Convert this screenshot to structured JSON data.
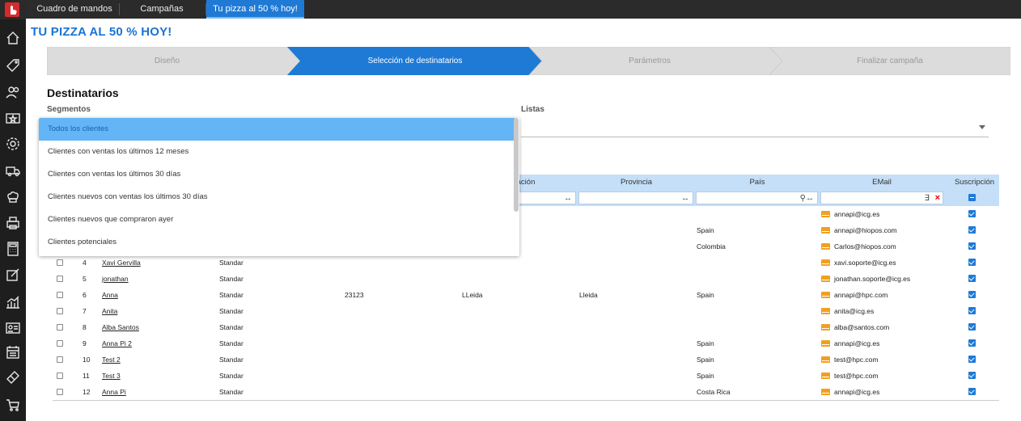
{
  "topbar": {
    "tabs": [
      {
        "label": "Cuadro de mandos"
      },
      {
        "label": "Campañas"
      },
      {
        "label": "Tu pizza al 50 % hoy!"
      }
    ]
  },
  "sidebar": {
    "icons": [
      "home-icon",
      "tag-icon",
      "users-icon",
      "star-ticket-icon",
      "gear-icon",
      "truck-icon",
      "chef-hat-icon",
      "printer-icon",
      "calculator-icon",
      "edit-icon",
      "chart-icon",
      "id-card-icon",
      "calendar-icon",
      "ticket-icon",
      "cart-icon"
    ]
  },
  "page": {
    "title": "TU PIZZA AL 50 % HOY!"
  },
  "wizard": {
    "steps": [
      {
        "label": "Diseño"
      },
      {
        "label": "Selección de destinatarios"
      },
      {
        "label": "Parámetros"
      },
      {
        "label": "Finalizar campaña"
      }
    ],
    "active_color": "#1f7ad6"
  },
  "recipients": {
    "title": "Destinatarios",
    "segments_label": "Segmentos",
    "lists_label": "Listas"
  },
  "grid": {
    "headers": {
      "poblacion": "ación",
      "provincia": "Provincia",
      "pais": "País",
      "email": "EMail",
      "suscripcion": "Suscripción"
    },
    "rows": [
      {
        "num": "",
        "name": "",
        "type": "",
        "cp": "",
        "pob": "",
        "prov": "",
        "pais": "",
        "email": "annapi@icg.es"
      },
      {
        "num": "",
        "name": "",
        "type": "",
        "cp": "",
        "pob": "",
        "prov": "",
        "pais": "Spain",
        "email": "annapi@hiopos.com"
      },
      {
        "num": "",
        "name": "",
        "type": "",
        "cp": "",
        "pob": "",
        "prov": "",
        "pais": "Colombia",
        "email": "Carlos@hiopos.com"
      },
      {
        "num": "4",
        "name": "Xavi Gervilla",
        "type": "Standar",
        "cp": "",
        "pob": "",
        "prov": "",
        "pais": "",
        "email": "xavi.soporte@icg.es"
      },
      {
        "num": "5",
        "name": "jonathan",
        "type": "Standar",
        "cp": "",
        "pob": "",
        "prov": "",
        "pais": "",
        "email": "jonathan.soporte@icg.es"
      },
      {
        "num": "6",
        "name": "Anna",
        "type": "Standar",
        "cp": "23123",
        "pob": "LLeida",
        "prov": "Lleida",
        "pais": "Spain",
        "email": "annapi@hpc.com"
      },
      {
        "num": "7",
        "name": "Anita",
        "type": "Standar",
        "cp": "",
        "pob": "",
        "prov": "",
        "pais": "",
        "email": "anita@icg.es"
      },
      {
        "num": "8",
        "name": "Alba Santos",
        "type": "Standar",
        "cp": "",
        "pob": "",
        "prov": "",
        "pais": "",
        "email": "alba@santos.com"
      },
      {
        "num": "9",
        "name": "Anna Pi 2",
        "type": "Standar",
        "cp": "",
        "pob": "",
        "prov": "",
        "pais": "Spain",
        "email": "annapi@icg.es"
      },
      {
        "num": "10",
        "name": "Test 2",
        "type": "Standar",
        "cp": "",
        "pob": "",
        "prov": "",
        "pais": "Spain",
        "email": "test@hpc.com"
      },
      {
        "num": "11",
        "name": "Test 3",
        "type": "Standar",
        "cp": "",
        "pob": "",
        "prov": "",
        "pais": "Spain",
        "email": "test@hpc.com"
      },
      {
        "num": "12",
        "name": "Anna Pi",
        "type": "Standar",
        "cp": "",
        "pob": "",
        "prov": "",
        "pais": "Costa Rica",
        "email": "annapi@icg.es"
      }
    ]
  },
  "dropdown": {
    "options": [
      {
        "label": "Todos los clientes"
      },
      {
        "label": "Clientes con ventas los últimos 12 meses"
      },
      {
        "label": "Clientes con ventas los últimos 30 días"
      },
      {
        "label": "Clientes nuevos con ventas los últimos 30 días"
      },
      {
        "label": "Clientes nuevos que compraron ayer"
      },
      {
        "label": "Clientes potenciales"
      }
    ],
    "selected_index": 0
  }
}
